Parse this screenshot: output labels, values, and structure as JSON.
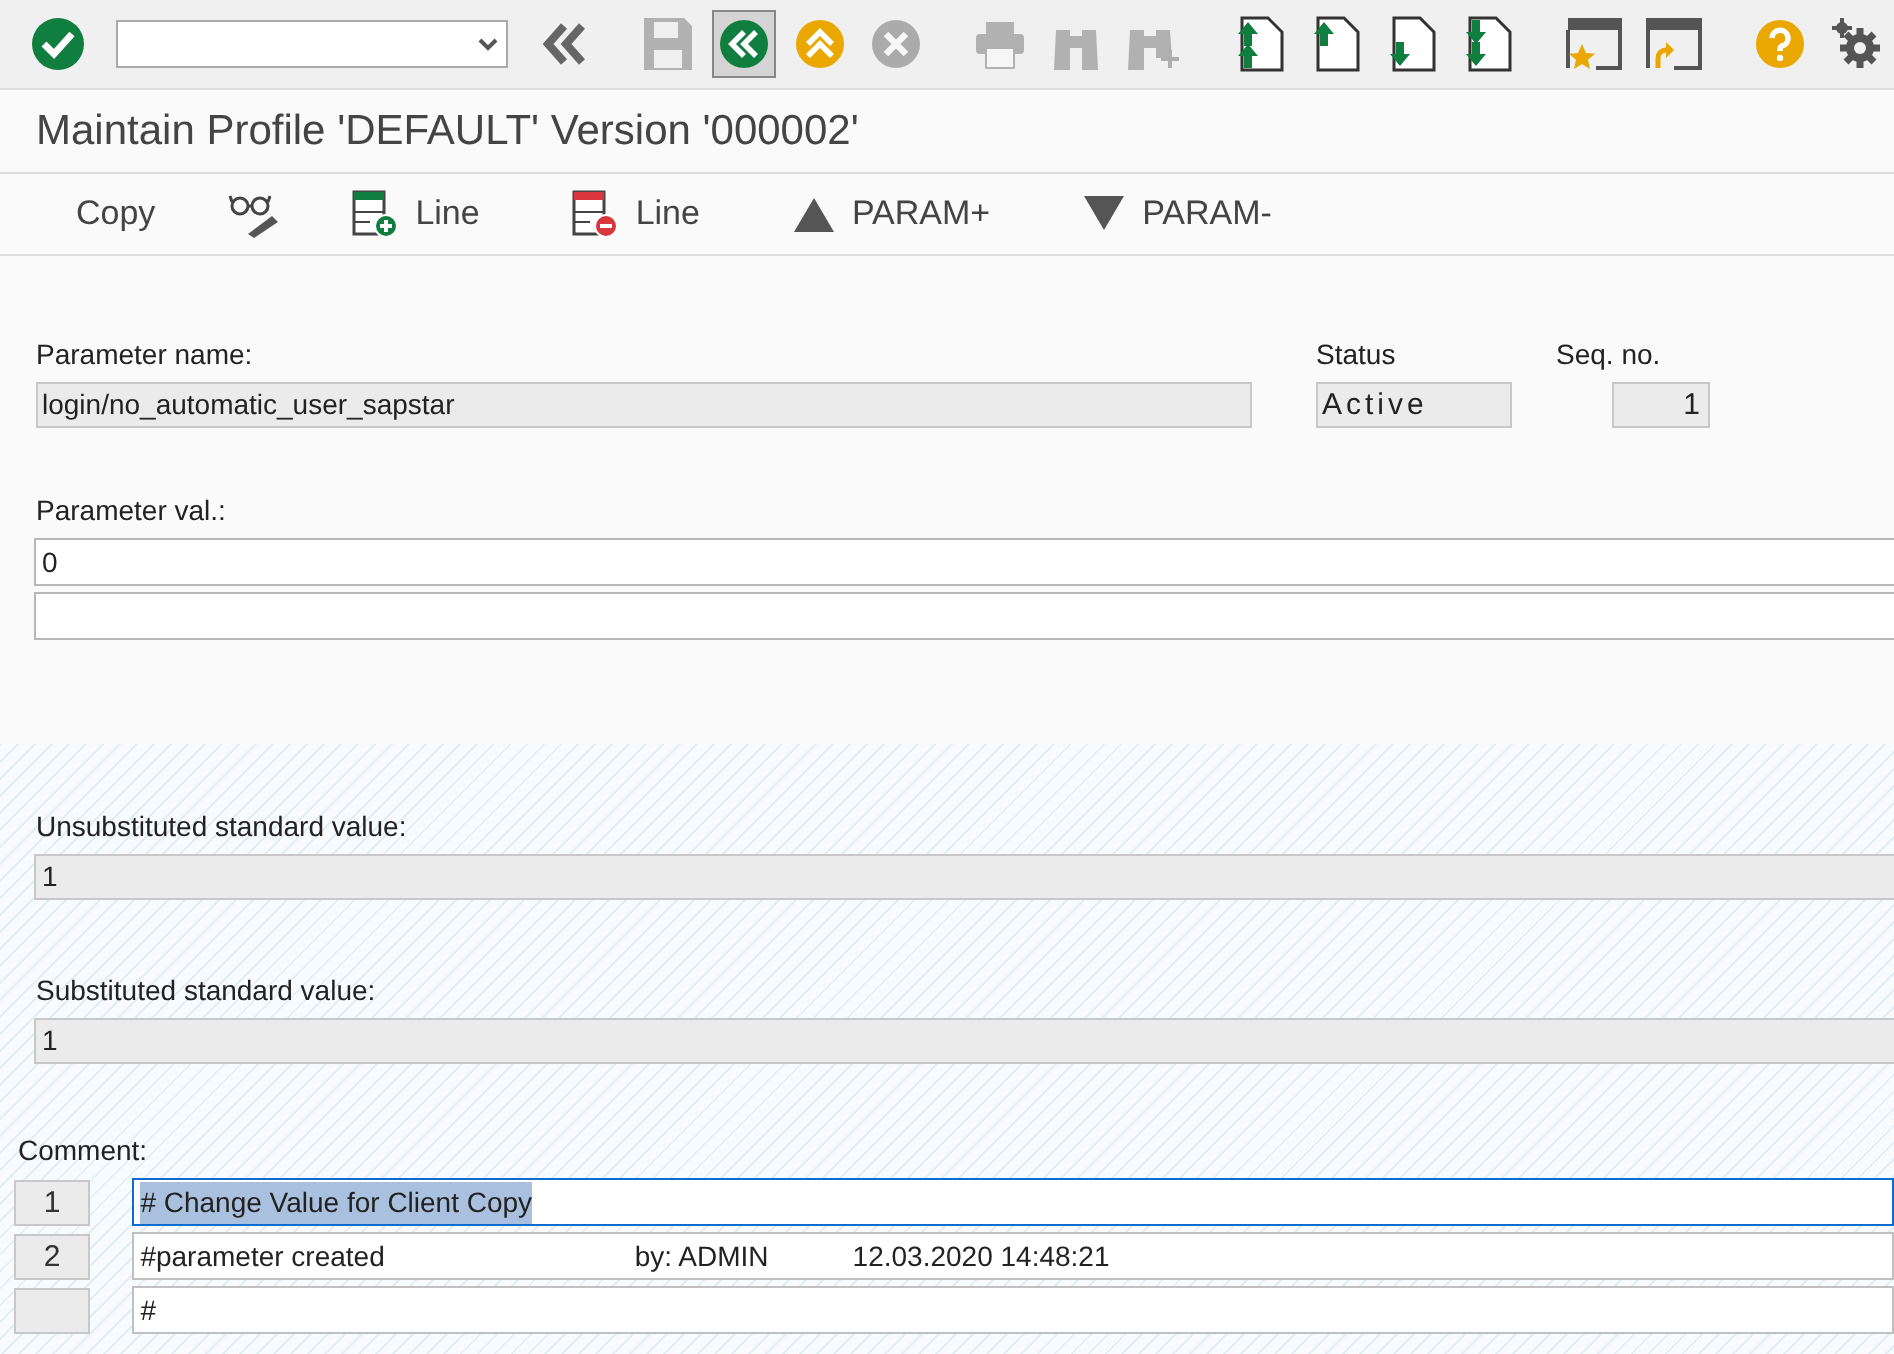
{
  "toolbar": [
    {
      "kind": "enter",
      "disabled": false,
      "pressed": false
    },
    {
      "kind": "collapse",
      "disabled": false,
      "pressed": false
    },
    {
      "kind": "save",
      "disabled": true,
      "pressed": false
    },
    {
      "kind": "back",
      "disabled": false,
      "pressed": true
    },
    {
      "kind": "exit",
      "disabled": false,
      "pressed": false
    },
    {
      "kind": "cancel",
      "disabled": true,
      "pressed": false
    },
    {
      "kind": "print",
      "disabled": true,
      "pressed": false
    },
    {
      "kind": "find",
      "disabled": true,
      "pressed": false
    },
    {
      "kind": "find_next",
      "disabled": true,
      "pressed": false
    },
    {
      "kind": "first_page",
      "disabled": false,
      "pressed": false
    },
    {
      "kind": "prev_page",
      "disabled": false,
      "pressed": false
    },
    {
      "kind": "next_page",
      "disabled": false,
      "pressed": false
    },
    {
      "kind": "last_page",
      "disabled": false,
      "pressed": false
    },
    {
      "kind": "new_session",
      "disabled": false,
      "pressed": false
    },
    {
      "kind": "shortcut",
      "disabled": false,
      "pressed": false
    },
    {
      "kind": "help",
      "disabled": false,
      "pressed": false
    },
    {
      "kind": "settings",
      "disabled": false,
      "pressed": false
    }
  ],
  "window": {
    "title": "Maintain Profile 'DEFAULT' Version '000002'"
  },
  "app_toolbar": [
    {
      "kind": "text",
      "label": "Copy"
    },
    {
      "kind": "glasses"
    },
    {
      "kind": "insert_line",
      "label": "Line"
    },
    {
      "kind": "delete_line",
      "label": "Line"
    },
    {
      "kind": "up",
      "label": "PARAM+"
    },
    {
      "kind": "down",
      "label": "PARAM-"
    }
  ],
  "parameter_name": {
    "label": "Parameter name:",
    "value": "login/no_automatic_user_sapstar"
  },
  "status": {
    "label": "Status",
    "value": "Active"
  },
  "seq_no": {
    "label": "Seq. no.",
    "value": "1"
  },
  "parameter_value": {
    "label": "Parameter val.:",
    "lines": [
      {
        "kind": "text",
        "value": "0"
      },
      {
        "kind": "blank"
      }
    ]
  },
  "unsubstituted_standard_value": {
    "label": "Unsubstituted standard value:",
    "value": "1"
  },
  "substituted_standard_value": {
    "label": "Substituted standard value:",
    "value": "1"
  },
  "comment": {
    "label": "Comment:",
    "lines": [
      {
        "number": "1",
        "selected": true,
        "parts": [
          "# Change Value for Client Copy"
        ]
      },
      {
        "number": "2",
        "selected": false,
        "parts": [
          "#parameter created",
          "by: ADMIN",
          "12.03.2020 14:48:21"
        ]
      },
      {
        "selected": false,
        "parts": [
          "#"
        ]
      }
    ]
  }
}
